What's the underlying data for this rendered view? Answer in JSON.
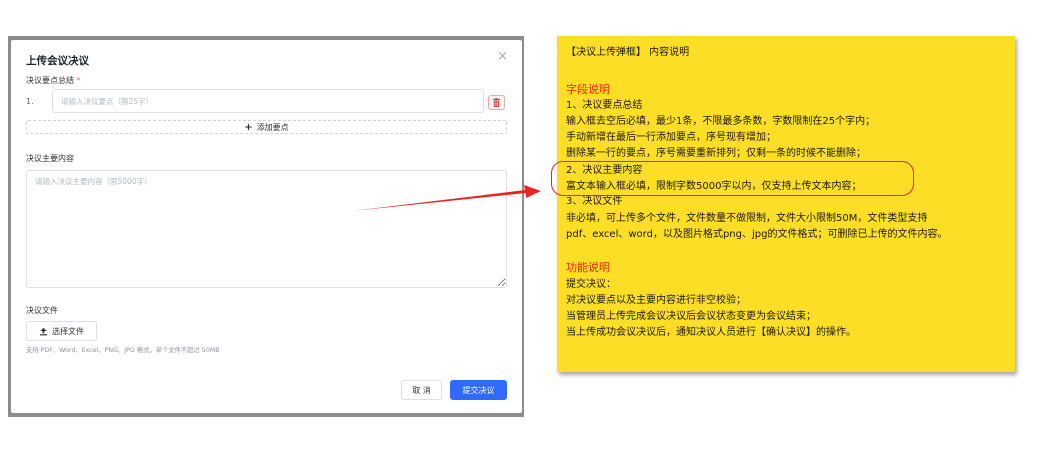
{
  "modal": {
    "title": "上传会议决议",
    "close": "×",
    "points_label": "决议要点总结",
    "required_mark": "*",
    "row_number": "1.",
    "point_placeholder": "请输入决议要点（限25字）",
    "add_point_label": "添加要点",
    "content_label": "决议主要内容",
    "content_placeholder": "请输入决议主要内容（限5000字）",
    "file_label": "决议文件",
    "choose_file_label": "选择文件",
    "file_hint": "支持 PDF、Word、Excel、PNG、JPG 格式，单个文件不超过 50MB",
    "cancel_label": "取 消",
    "submit_label": "提交决议"
  },
  "note": {
    "title": "【决议上传弹框】 内容说明",
    "field_head": "字段说明",
    "field_lines": [
      "1、决议要点总结",
      "    输入框去空后必填，最少1条，不限最多条数，字数限制在25个字内；",
      "    手动新增在最后一行添加要点，序号现有增加；",
      "    删除某一行的要点，序号需要重新排列；仅剩一条的时候不能删除；",
      "2、决议主要内容",
      "    富文本输入框必填，限制字数5000字以内，仅支持上传文本内容；",
      "3、决议文件",
      "    非必填，可上传多个文件，文件数量不做限制，文件大小限制50M，文件类型支持",
      "pdf、excel、word，以及图片格式png、jpg的文件格式；可删除已上传的文件内容。"
    ],
    "func_head": "功能说明",
    "func_lines": [
      "提交决议：",
      "  对决议要点以及主要内容进行非空校验；",
      "  当管理员上传完成会议决议后会议状态变更为会议结束；",
      "  当上传成功会议决议后，通知决议人员进行【确认决议】的操作。"
    ]
  },
  "colors": {
    "primary": "#2f6bff",
    "danger": "#f56c6c",
    "note_bg": "#fcde27",
    "annotation_red": "#e8241e"
  }
}
